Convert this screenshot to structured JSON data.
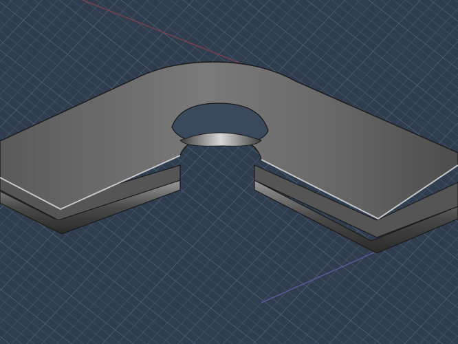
{
  "viewport": {
    "background_color": "#2f3d4f",
    "grid_minor_color": "#4a5a6c",
    "grid_major_color": "#5c6d80",
    "axis_x_color": "#7a4050",
    "axis_y_color": "#5a5a9a"
  },
  "model": {
    "shape": "elbow-bracket",
    "fill_top": "#6e6e6e",
    "edge_color": "#1a1a1a"
  }
}
